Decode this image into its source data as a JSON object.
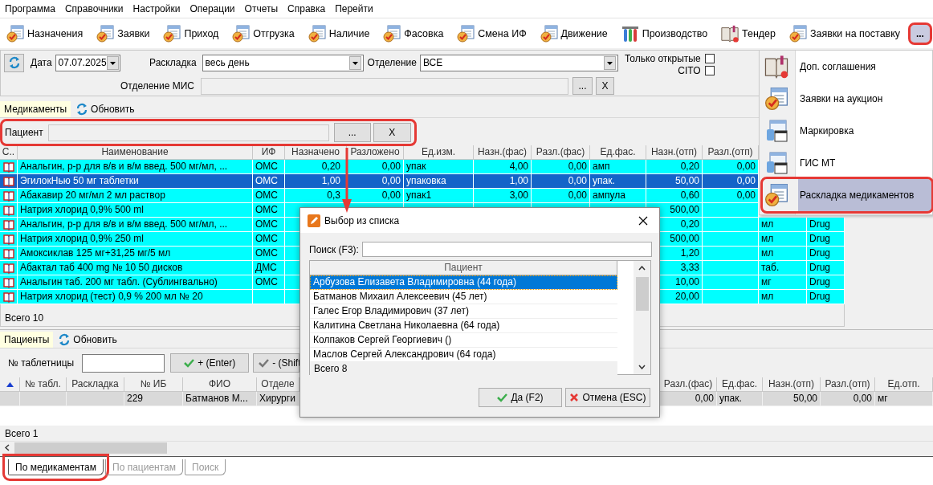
{
  "menu_bar": [
    "Программа",
    "Справочники",
    "Настройки",
    "Операции",
    "Отчеты",
    "Справка",
    "Перейти"
  ],
  "toolbar": {
    "buttons": [
      "Назначения",
      "Заявки",
      "Приход",
      "Отгрузка",
      "Наличие",
      "Фасовка",
      "Смена ИФ",
      "Движение",
      "Производство",
      "Тендер",
      "Заявки на поставку"
    ],
    "more_button": {
      "label": "...",
      "highlighted": true
    }
  },
  "filters": {
    "date_label": "Дата",
    "date": "07.07.2025",
    "layout_label": "Раскладка",
    "layout": "весь день",
    "department_label": "Отделение",
    "department": "ВСЕ",
    "only_open": {
      "label": "Только открытые",
      "checked": false
    },
    "cito": {
      "label": "CITO",
      "checked": false
    },
    "mis_label": "Отделение МИС",
    "mis_pick": "...",
    "mis_clear": "X"
  },
  "medications": {
    "tab": {
      "label": "Медикаменты",
      "selected": true
    },
    "refresh": "Обновить",
    "patient_filter": {
      "label": "Пациент",
      "pick": "...",
      "clear": "X",
      "highlighted": true
    },
    "table": {
      "columns": [
        "С..",
        "Наименование",
        "ИФ",
        "Назначено",
        "Разложено",
        "Ед.изм.",
        "Назн.(фас)",
        "Разл.(фас)",
        "Ед.фас.",
        "Назн.(отп)",
        "Разл.(отп)",
        null,
        null
      ],
      "rows": [
        {
          "selected": false,
          "cells": [
            null,
            "Анальгин, р-р для в/в и в/м введ. 500 мг/мл, ...",
            "ОМС",
            "0,20",
            "0,00",
            "упак",
            "4,00",
            "0,00",
            "амп",
            "0,20",
            "0,00",
            null,
            null
          ]
        },
        {
          "selected": true,
          "cells": [
            null,
            "ЭгилокНью 50 мг таблетки",
            "ОМС",
            "1,00",
            "0,00",
            "упаковка",
            "1,00",
            "0,00",
            "упак.",
            "50,00",
            "0,00",
            null,
            null
          ]
        },
        {
          "selected": false,
          "cells": [
            null,
            "Абакавир 20 мг/мл 2 мл раствор",
            "ОМС",
            "0,3",
            "0,00",
            "упак1",
            "3,00",
            "0,00",
            "ампула",
            "0,60",
            "0,00",
            null,
            null
          ]
        },
        {
          "selected": false,
          "cells": [
            null,
            "Натрия хлорид 0,9% 500 ml",
            "ОМС",
            null,
            null,
            null,
            null,
            null,
            null,
            "500,00",
            null,
            null,
            null
          ]
        },
        {
          "selected": false,
          "cells": [
            null,
            "Анальгин, р-р для в/в и в/м введ. 500 мг/мл, ...",
            "ОМС",
            null,
            null,
            null,
            null,
            null,
            null,
            "0,20",
            null,
            "мл",
            "Drug"
          ]
        },
        {
          "selected": false,
          "cells": [
            null,
            "Натрия хлорид 0,9% 250 ml",
            "ОМС",
            null,
            null,
            null,
            null,
            null,
            null,
            "500,00",
            null,
            "мл",
            "Drug"
          ]
        },
        {
          "selected": false,
          "cells": [
            null,
            "Амоксиклав 125 мг+31,25 мг/5 мл",
            "ОМС",
            null,
            null,
            null,
            null,
            null,
            null,
            "1,20",
            null,
            "мл",
            "Drug"
          ]
        },
        {
          "selected": false,
          "cells": [
            null,
            "Абактал таб 400 mg № 10 50 дисков",
            "ДМС",
            null,
            null,
            null,
            null,
            null,
            null,
            "3,33",
            null,
            "таб.",
            "Drug"
          ]
        },
        {
          "selected": false,
          "cells": [
            null,
            "Анальгин таб. 200 мг табл. (Сублингвально)",
            "ОМС",
            null,
            null,
            null,
            null,
            null,
            null,
            "10,00",
            null,
            "мг",
            "Drug"
          ]
        },
        {
          "selected": false,
          "cells": [
            null,
            "Натрия хлорид (тест) 0,9 % 200 мл № 20",
            null,
            null,
            null,
            null,
            null,
            null,
            null,
            "20,00",
            null,
            "мл",
            "Drug"
          ]
        }
      ]
    },
    "total": "Всего 10"
  },
  "patients": {
    "tab": {
      "label": "Пациенты",
      "selected": true
    },
    "refresh": "Обновить",
    "tray_label": "№ таблетницы",
    "add_button": "+ (Enter)",
    "remove_button": "- (Shift",
    "table": {
      "columns": [
        null,
        "№ табл.",
        "Раскладка",
        "№ ИБ",
        "ФИО",
        "Отделе",
        null,
        "Разл.(фас)",
        "Ед.фас.",
        "Назн.(отп)",
        "Разл.(отп)",
        "Ед.отп."
      ],
      "rows": [
        {
          "selected": true,
          "cells": [
            null,
            null,
            null,
            "229",
            "Батманов М...",
            "Хирурги",
            null,
            "0,00",
            "упак.",
            "50,00",
            "0,00",
            "мг"
          ]
        }
      ]
    },
    "total": "Всего 1"
  },
  "bottom_tabs": [
    {
      "label": "По медикаментам",
      "selected": true,
      "highlighted": true
    },
    {
      "label": "По пациентам",
      "selected": false,
      "highlighted": false
    },
    {
      "label": "Поиск",
      "selected": false,
      "highlighted": false
    }
  ],
  "dropdown_menu": {
    "items": [
      {
        "label": "Доп. соглашения",
        "selected": false,
        "highlighted": false
      },
      {
        "label": "Заявки на аукцион",
        "selected": false,
        "highlighted": false
      },
      {
        "label": "Маркировка",
        "selected": false,
        "highlighted": false
      },
      {
        "label": "ГИС МТ",
        "selected": false,
        "highlighted": false
      },
      {
        "label": "Раскладка медикаментов",
        "selected": true,
        "highlighted": true
      }
    ]
  },
  "dialog": {
    "title": "Выбор из списка",
    "search_label": "Поиск (F3):",
    "column": "Пациент",
    "items": [
      {
        "label": "Арбузова Елизавета Владимировна (44 года)",
        "selected": true
      },
      {
        "label": "Батманов Михаил Алексеевич (45 лет)",
        "selected": false
      },
      {
        "label": "Галес Егор Владимирович (37 лет)",
        "selected": false
      },
      {
        "label": "Калитина Светлана Николаевна (64 года)",
        "selected": false
      },
      {
        "label": "Колпаков Сергей Георгиевич ()",
        "selected": false
      },
      {
        "label": "Маслов Сергей Александрович (64 года)",
        "selected": false
      }
    ],
    "total": "Всего 8",
    "ok_button": "Да (F2)",
    "cancel_button": "Отмена (ESC)"
  }
}
